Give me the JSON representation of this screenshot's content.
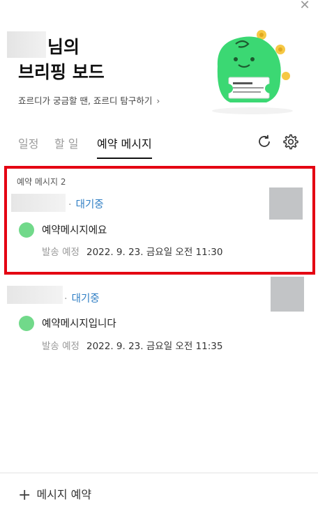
{
  "header": {
    "title_line1": "님의",
    "title_line2": "브리핑 보드",
    "subtitle_link": "죠르디가 궁금할 땐, 죠르디 탐구하기"
  },
  "tabs": [
    {
      "label": "일정"
    },
    {
      "label": "할 일"
    },
    {
      "label": "예약 메시지"
    }
  ],
  "reserved_messages": {
    "section_label": "예약 메시지 2",
    "items": [
      {
        "status": "대기중",
        "message": "예약메시지에요",
        "schedule_label": "발송 예정",
        "schedule_time": "2022. 9. 23. 금요일 오전 11:30"
      },
      {
        "status": "대기중",
        "message": "예약메시지입니다",
        "schedule_label": "발송 예정",
        "schedule_time": "2022. 9. 23. 금요일 오전 11:35"
      }
    ]
  },
  "footer": {
    "add_label": "메시지 예약"
  },
  "icons": {
    "close": "close-icon",
    "refresh": "refresh-icon",
    "settings": "gear-icon",
    "plus": "plus-icon",
    "chevron": "chevron-right-icon"
  },
  "colors": {
    "highlight": "#e40012",
    "status": "#2f7ec4",
    "mascot": "#3bd873"
  }
}
